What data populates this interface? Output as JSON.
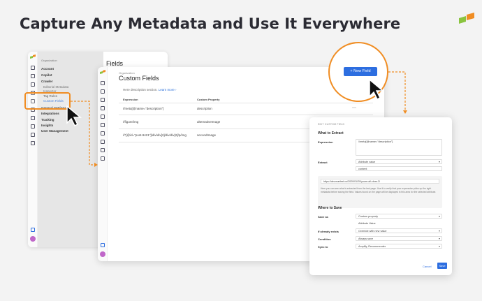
{
  "headline": "Capture Any Metadata and Use It Everywhere",
  "colors": {
    "accent": "#f08d23",
    "primary": "#2d6ee0",
    "logo_green": "#8ac43f"
  },
  "window1": {
    "org_label": "Organization",
    "nav": [
      "Account",
      "Copilot",
      "Crawler",
      "Editorial Metadata",
      "Inspector",
      "Tag Rules",
      "Custom Fields",
      "General Settings",
      "Integrations",
      "Tracking",
      "Insights",
      "User Management"
    ],
    "title": "Fields",
    "desc_snippet": "Here description section. Learn more",
    "bg_text": "description"
  },
  "window2": {
    "org_label": "Organization",
    "title": "Custom Fields",
    "description": "Here description section.",
    "learn_more": "Learn more ›",
    "columns": [
      "Expression",
      "Custom Property"
    ],
    "rows": [
      {
        "expression": "//meta[@name=\"description\"]",
        "property": "description"
      },
      {
        "expression": "//figure/img",
        "property": "alternativeImage"
      },
      {
        "expression": "//*[@id=\"post-9421\"]/div/div[2]/div/div[2]/p/img",
        "property": "secondImage"
      }
    ],
    "more_icon": "⋯"
  },
  "new_field_button": "+ New Field",
  "dialog": {
    "top_label": "EDIT CUSTOM FIELD",
    "section_extract": "What to Extract",
    "expression_label": "Expression",
    "expression_value": "//meta[@name=\"description\"]",
    "extract_label": "Extract",
    "extract_value": "Attribute value",
    "attribute_value": "content",
    "test_url": "https://dev.marfeel.co/2020/01/20/youre-all-clear-2/",
    "preview_text": "Here you can see what is extracted from the test page. Use it to verify that your expression picks up the right metadata before saving the field. Values found on the page will be displayed in this area for the selected attribute.",
    "section_save": "Where to Save",
    "save_as_label": "Save as",
    "save_as_value": "Custom property",
    "save_as_sub": "Attribute Value",
    "if_exists_label": "If already exists",
    "if_exists_value": "Override with new value",
    "condition_label": "Condition",
    "condition_value": "Always save",
    "sync_label": "Sync to",
    "sync_value": "Amplify, Recommender",
    "cancel": "Cancel",
    "save": "Save"
  }
}
